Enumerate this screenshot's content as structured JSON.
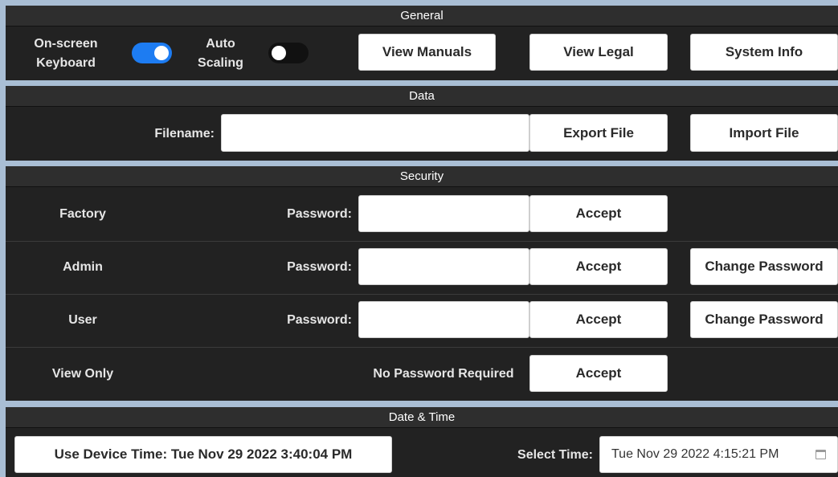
{
  "general": {
    "header": "General",
    "onscreen_keyboard_label_1": "On-screen",
    "onscreen_keyboard_label_2": "Keyboard",
    "onscreen_keyboard_on": true,
    "auto_scaling_label_1": "Auto",
    "auto_scaling_label_2": "Scaling",
    "auto_scaling_on": false,
    "view_manuals": "View Manuals",
    "view_legal": "View Legal",
    "system_info": "System Info"
  },
  "data": {
    "header": "Data",
    "filename_label": "Filename:",
    "filename_value": "",
    "export_file": "Export File",
    "import_file": "Import File"
  },
  "security": {
    "header": "Security",
    "rows": [
      {
        "role": "Factory",
        "password_label": "Password:",
        "accept": "Accept",
        "change": ""
      },
      {
        "role": "Admin",
        "password_label": "Password:",
        "accept": "Accept",
        "change": "Change Password"
      },
      {
        "role": "User",
        "password_label": "Password:",
        "accept": "Accept",
        "change": "Change Password"
      },
      {
        "role": "View Only",
        "password_label": "No Password Required",
        "accept": "Accept",
        "change": ""
      }
    ]
  },
  "datetime": {
    "header": "Date & Time",
    "use_device_time": "Use Device Time: Tue Nov 29 2022 3:40:04 PM",
    "select_time_label": "Select Time:",
    "select_time_value": "Tue Nov 29 2022 4:15:21 PM",
    "calendar_icon": "calendar-icon"
  },
  "colors": {
    "toggle_on": "#1d7cf2",
    "toggle_off": "#111111",
    "panel_bg": "#222222",
    "separator": "#a9bed4"
  }
}
